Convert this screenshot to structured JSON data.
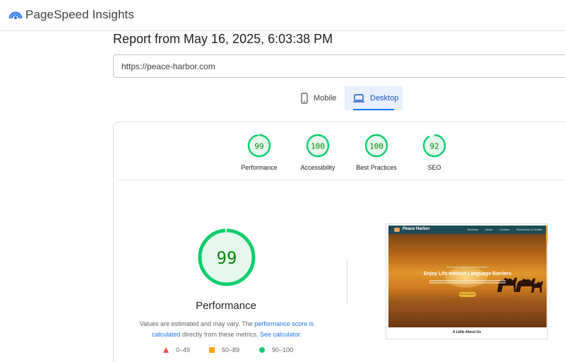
{
  "app": {
    "title": "PageSpeed Insights",
    "logo_icon": "pagespeed-gauge-icon"
  },
  "report": {
    "title": "Report from May 16, 2025, 6:03:38 PM",
    "url": "https://peace-harbor.com"
  },
  "tabs": [
    {
      "label": "Mobile",
      "icon": "mobile-phone-icon",
      "selected": false
    },
    {
      "label": "Desktop",
      "icon": "laptop-icon",
      "selected": true
    }
  ],
  "categories": [
    {
      "score": "99",
      "label": "Performance",
      "value": 99
    },
    {
      "score": "100",
      "label": "Accessibility",
      "value": 100
    },
    {
      "score": "100",
      "label": "Best Practices",
      "value": 100
    },
    {
      "score": "92",
      "label": "SEO",
      "value": 92
    }
  ],
  "performance": {
    "score": "99",
    "value": 99,
    "label": "Performance",
    "note_part1": "Values are estimated and may vary. The ",
    "note_link1": "performance score is calculated",
    "note_part2": " directly from these metrics. ",
    "note_link2": "See calculator",
    "note_part3": "."
  },
  "legend": [
    {
      "range": "0–49",
      "shape": "triangle",
      "color": "#ff4e42"
    },
    {
      "range": "50–89",
      "shape": "square",
      "color": "#ffa400"
    },
    {
      "range": "90–100",
      "shape": "circle",
      "color": "#0cce6b"
    }
  ],
  "screenshot": {
    "brand": "Peace Harbor",
    "nav_links": [
      "Services",
      "About",
      "Contact",
      "Resources & Guides"
    ],
    "kicker": "Seamless Global Communication",
    "headline": "Enjoy Life without Language Barriers",
    "button": "Book a Session",
    "section_title": "A Little About Us"
  },
  "colors": {
    "good": "#0cce6b",
    "good_text": "#008800",
    "good_fill": "#e6f8ee",
    "accent": "#1a73e8"
  }
}
